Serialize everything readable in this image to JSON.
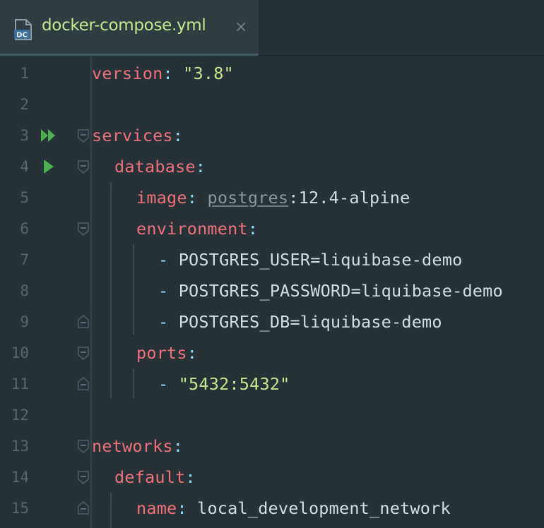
{
  "tab": {
    "title": "docker-compose.yml",
    "close_glyph": "×",
    "icon": "docker-compose-file-icon",
    "icon_text": "DC"
  },
  "lines": [
    {
      "num": "1"
    },
    {
      "num": "2"
    },
    {
      "num": "3"
    },
    {
      "num": "4"
    },
    {
      "num": "5"
    },
    {
      "num": "6"
    },
    {
      "num": "7"
    },
    {
      "num": "8"
    },
    {
      "num": "9"
    },
    {
      "num": "10"
    },
    {
      "num": "11"
    },
    {
      "num": "12"
    },
    {
      "num": "13"
    },
    {
      "num": "14"
    },
    {
      "num": "15"
    }
  ],
  "code": {
    "l1": {
      "key": "version",
      "colon": ":",
      "value": " \"3.8\""
    },
    "l3": {
      "key": "services",
      "colon": ":"
    },
    "l4": {
      "key": "database",
      "colon": ":"
    },
    "l5": {
      "key": "image",
      "colon": ":",
      "space": " ",
      "ref": "postgres",
      "rest": ":12.4-alpine"
    },
    "l6": {
      "key": "environment",
      "colon": ":"
    },
    "l7": {
      "dash": "- ",
      "value": "POSTGRES_USER=liquibase-demo"
    },
    "l8": {
      "dash": "- ",
      "value": "POSTGRES_PASSWORD=liquibase-demo"
    },
    "l9": {
      "dash": "- ",
      "value": "POSTGRES_DB=liquibase-demo"
    },
    "l10": {
      "key": "ports",
      "colon": ":"
    },
    "l11": {
      "dash": "- ",
      "value": "\"5432:5432\""
    },
    "l13": {
      "key": "networks",
      "colon": ":"
    },
    "l14": {
      "key": "default",
      "colon": ":"
    },
    "l15": {
      "key": "name",
      "colon": ":",
      "value": " local_development_network"
    }
  },
  "colors": {
    "background": "#263238",
    "key": "#f07178",
    "string": "#c3e88d",
    "punctuation": "#89ddff",
    "run_icon": "#4caf50"
  },
  "gutter_icons": {
    "line3": "run-all-icon",
    "line4": "run-icon"
  }
}
